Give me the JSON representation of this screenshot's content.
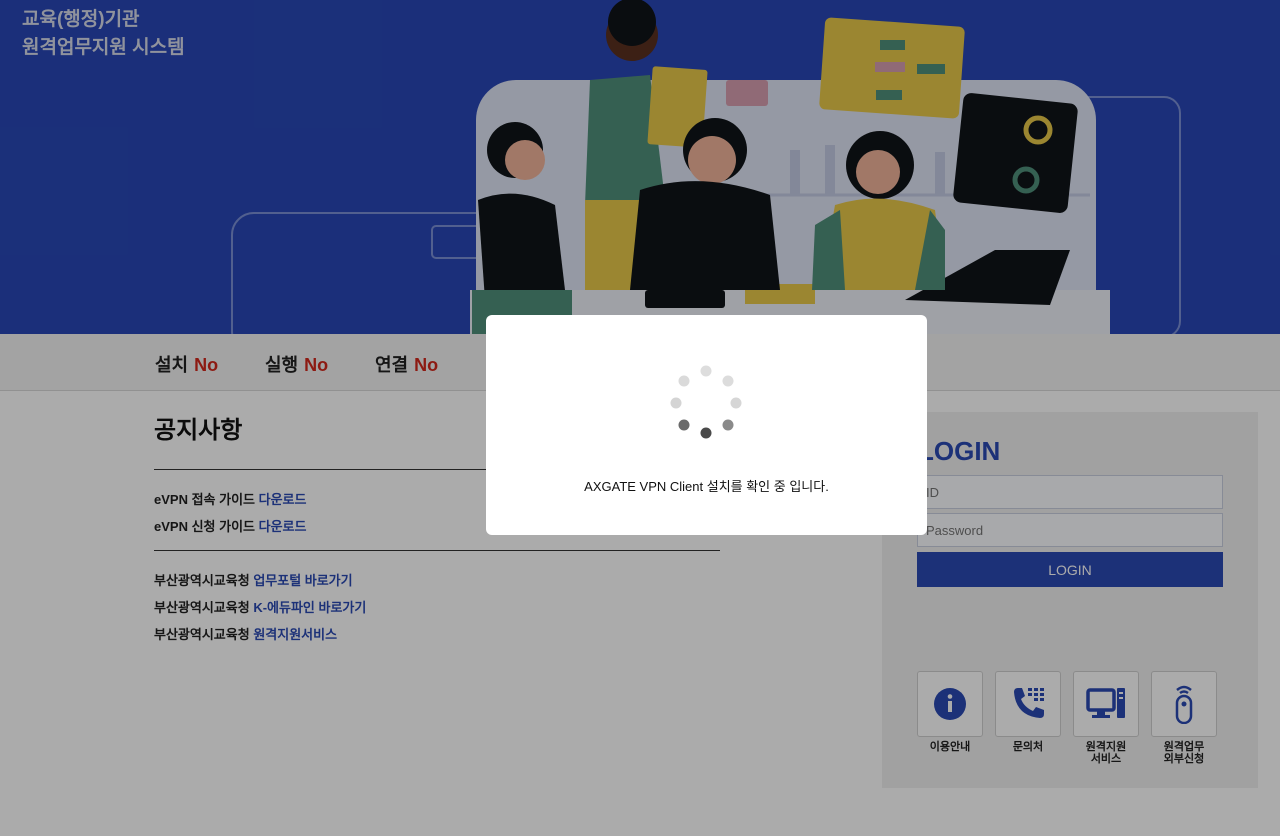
{
  "header": {
    "title_line1": "교육(행정)기관",
    "title_line2": "원격업무지원 시스템"
  },
  "status": {
    "install_label": "설치",
    "install_value": "No",
    "run_label": "실행",
    "run_value": "No",
    "connect_label": "연결",
    "connect_value": "No"
  },
  "notice": {
    "title": "공지사항",
    "guides": [
      {
        "label": "eVPN 접속 가이드",
        "link": "다운로드"
      },
      {
        "label": "eVPN 신청 가이드",
        "link": "다운로드"
      }
    ],
    "links": [
      {
        "label": "부산광역시교육청",
        "link": "업무포털 바로가기"
      },
      {
        "label": "부산광역시교육청",
        "link": "K-에듀파인 바로가기"
      },
      {
        "label": "부산광역시교육청",
        "link": "원격지원서비스"
      }
    ]
  },
  "login": {
    "title": "LOGIN",
    "id_placeholder": "ID",
    "password_placeholder": "Password",
    "button": "LOGIN"
  },
  "quick_menu": [
    {
      "icon": "info-icon",
      "label1": "이용안내",
      "label2": ""
    },
    {
      "icon": "phone-icon",
      "label1": "문의처",
      "label2": ""
    },
    {
      "icon": "computer-icon",
      "label1": "원격지원",
      "label2": "서비스"
    },
    {
      "icon": "remote-icon",
      "label1": "원격업무",
      "label2": "외부신청"
    }
  ],
  "modal": {
    "message": "AXGATE VPN Client 설치를 확인 중 입니다."
  },
  "colors": {
    "brand": "#2a49b3",
    "status_no": "#d2271c"
  }
}
